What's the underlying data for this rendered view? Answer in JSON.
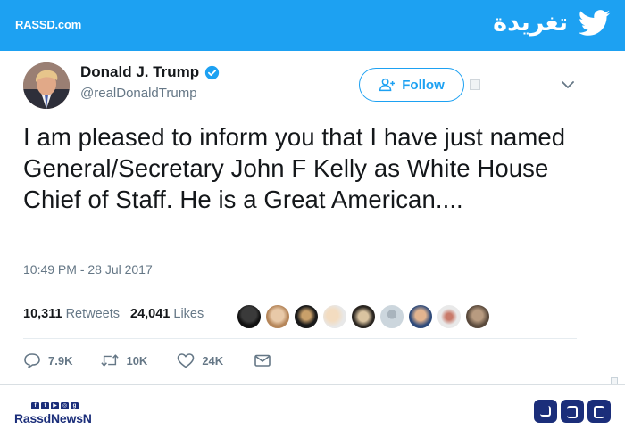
{
  "header": {
    "site_label": "RASSD.com",
    "brand_text": "تغريدة",
    "background_color": "#1da1f2"
  },
  "tweet": {
    "display_name": "Donald J. Trump",
    "handle": "@realDonaldTrump",
    "verified": true,
    "follow_label": "Follow",
    "text": "I am pleased to inform you that I have just named General/Secretary John F Kelly as White House Chief of Staff. He is a Great American....",
    "timestamp": "10:49 PM - 28 Jul 2017",
    "stats": {
      "retweets_count": "10,311",
      "retweets_label": "Retweets",
      "likes_count": "24,041",
      "likes_label": "Likes"
    },
    "actions": {
      "reply_count": "7.9K",
      "retweet_count": "10K",
      "like_count": "24K"
    },
    "accent_color": "#1da1f2"
  },
  "footer": {
    "social_handle": "RassdNewsN",
    "brand_color": "#1b2e7a"
  }
}
